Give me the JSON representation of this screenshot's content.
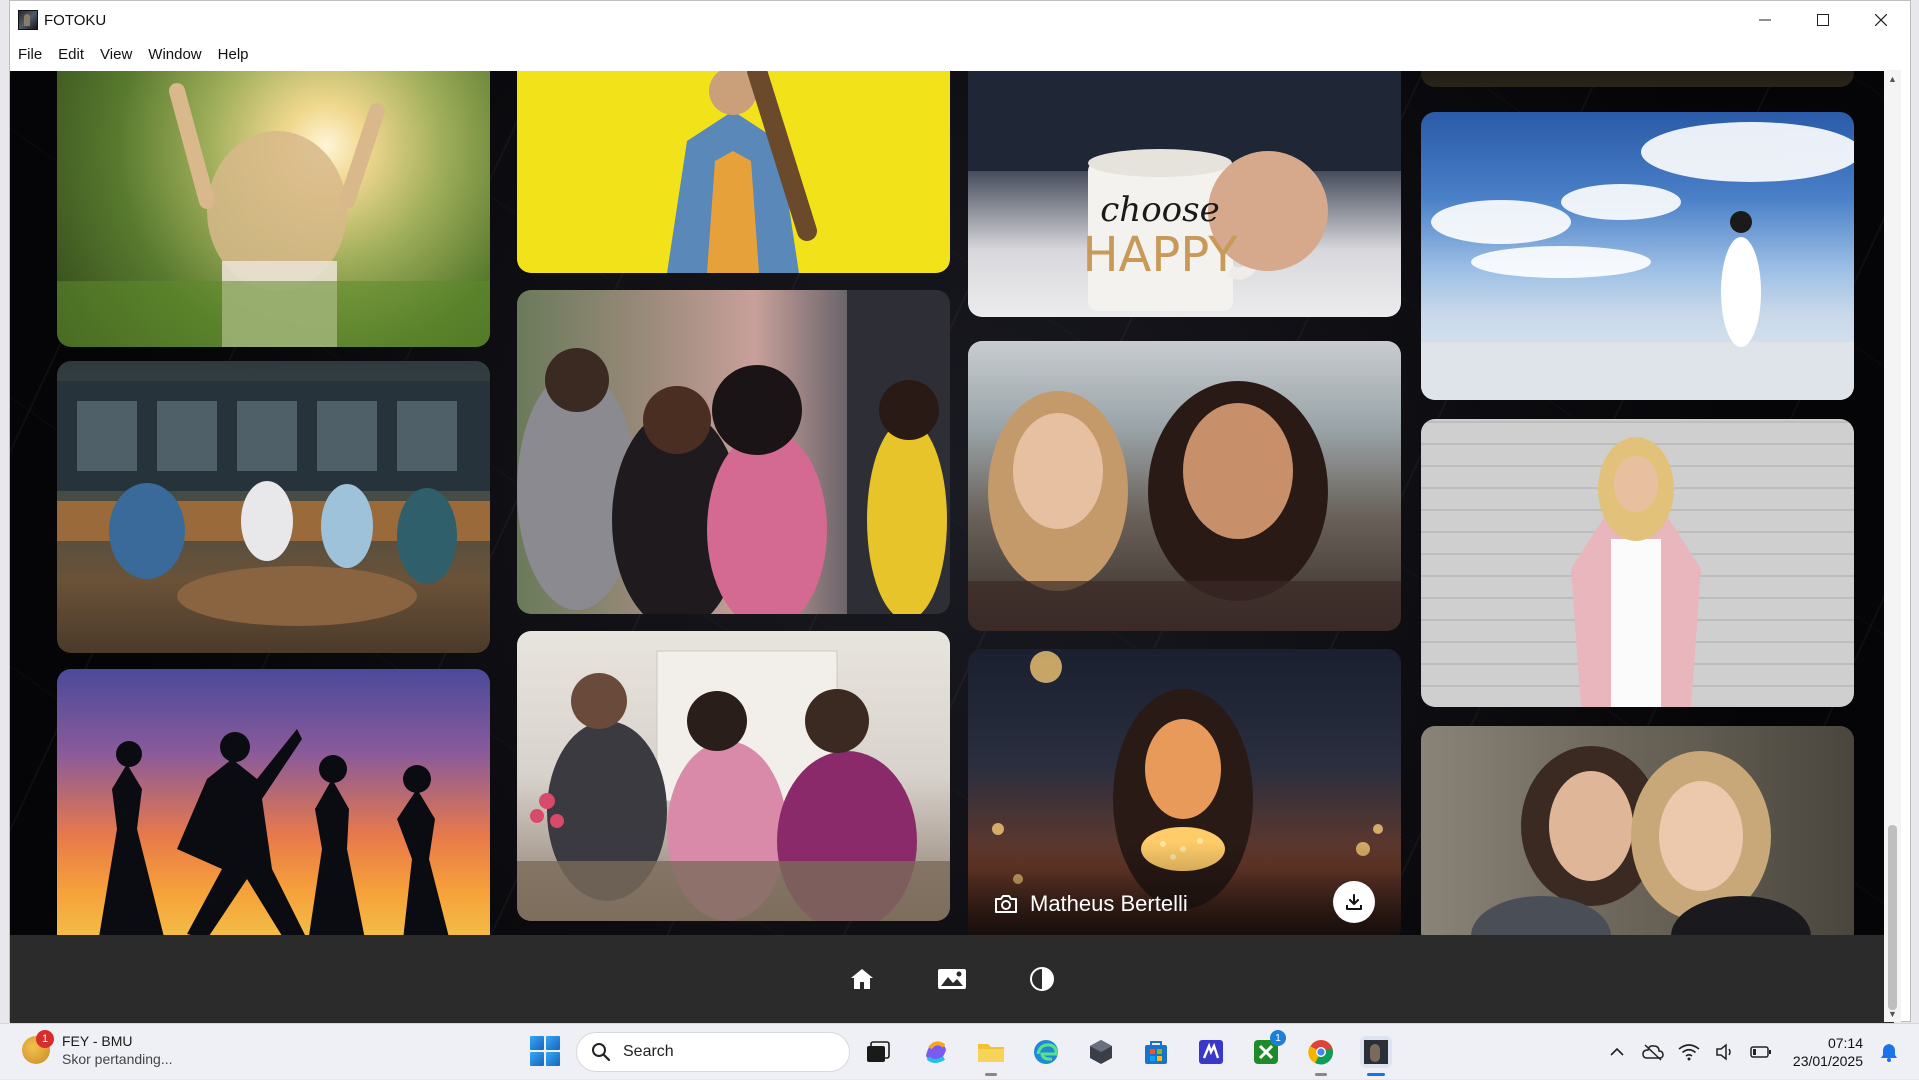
{
  "window": {
    "title": "FOTOKU",
    "menu": [
      "File",
      "Edit",
      "View",
      "Window",
      "Help"
    ]
  },
  "gallery": {
    "photos": [
      {
        "id": "woman-sunlight-field"
      },
      {
        "id": "woman-yellow-wall"
      },
      {
        "id": "choose-happy-mug",
        "mug_text_line1": "choose",
        "mug_text_line2": "HAPPY"
      },
      {
        "id": "woman-salt-flat"
      },
      {
        "id": "friends-cafe-terrace"
      },
      {
        "id": "friends-laughing-street"
      },
      {
        "id": "two-women-smiling-lake"
      },
      {
        "id": "woman-brick-wall"
      },
      {
        "id": "silhouettes-sunset"
      },
      {
        "id": "women-office-table"
      },
      {
        "id": "woman-fairy-lights"
      },
      {
        "id": "two-women-portrait"
      }
    ],
    "hovered_credit": "Matheus Bertelli"
  },
  "bottom_nav": [
    "home-icon",
    "gallery-icon",
    "theme-toggle-icon"
  ],
  "taskbar": {
    "weather_title": "FEY - BMU",
    "weather_subtitle": "Skor pertanding...",
    "weather_badge": "1",
    "search_placeholder": "Search",
    "xbox_badge": "1",
    "time": "07:14",
    "date": "23/01/2025"
  },
  "colors": {
    "content_bg": "#0a0a0e",
    "bottom_nav_bg": "#2b2b2b",
    "taskbar_bg": "#eef0f5",
    "accent": "#1a73e8"
  }
}
